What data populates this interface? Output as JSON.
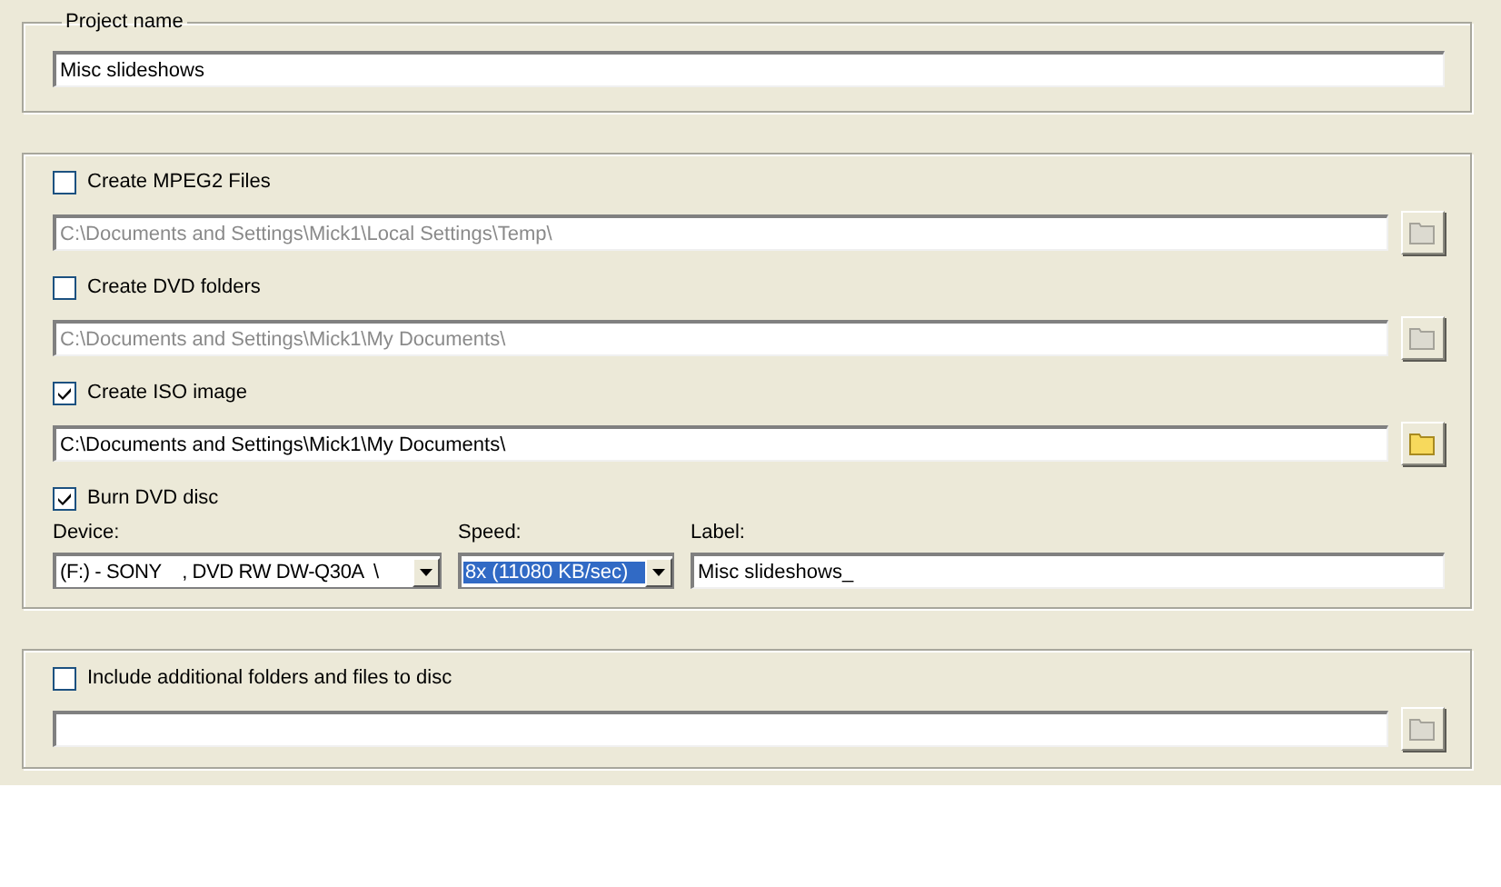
{
  "project_name": {
    "legend": "Project name",
    "value": "Misc slideshows"
  },
  "outputs": [
    {
      "label": "Create MPEG2 Files",
      "checked": false,
      "path": "C:\\Documents and Settings\\Mick1\\Local Settings\\Temp\\"
    },
    {
      "label": "Create DVD folders",
      "checked": false,
      "path": "C:\\Documents and Settings\\Mick1\\My Documents\\"
    },
    {
      "label": "Create ISO image",
      "checked": true,
      "path": "C:\\Documents and Settings\\Mick1\\My Documents\\"
    }
  ],
  "burn": {
    "label": "Burn DVD disc",
    "checked": true,
    "device": {
      "label": "Device:",
      "value": "(F:) - SONY    , DVD RW DW-Q30A  \\"
    },
    "speed": {
      "label": "Speed:",
      "value": "8x (11080 KB/sec)",
      "selected": true
    },
    "disc_label": {
      "label": "Label:",
      "value": "Misc slideshows_"
    }
  },
  "additional": {
    "label": "Include additional folders and files to disc",
    "checked": false
  }
}
